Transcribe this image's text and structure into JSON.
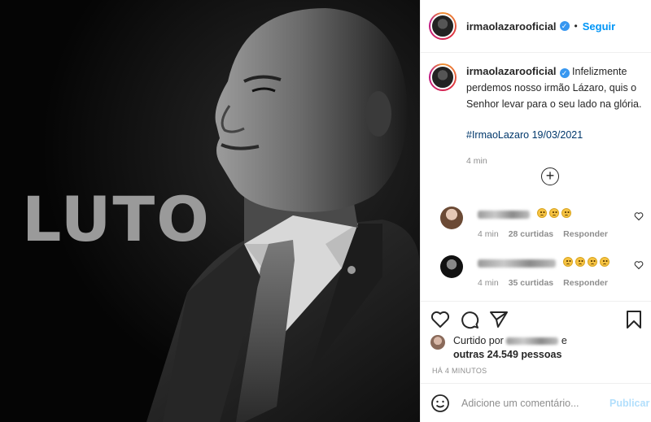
{
  "post": {
    "image_text": "LUTO",
    "header": {
      "username": "irmaolazarooficial",
      "verified_icon": "verified-badge-icon",
      "separator": "•",
      "follow_label": "Seguir"
    },
    "caption": {
      "username": "irmaolazarooficial",
      "text": "Infelizmente perdemos nosso irmão Lázaro, quis o Senhor levar para o seu lado na glória.",
      "hashtag": "#IrmaoLazaro",
      "date": "19/03/2021",
      "time": "4 min"
    },
    "comments": [
      {
        "time": "4 min",
        "likes": "28 curtidas",
        "reply": "Responder",
        "emoji_count": 3
      },
      {
        "time": "4 min",
        "likes": "35 curtidas",
        "reply": "Responder",
        "emoji_count": 4
      }
    ],
    "likes": {
      "prefix": "Curtido por",
      "conj": "e",
      "others": "outras 24.549 pessoas"
    },
    "timestamp": "HÁ 4 MINUTOS",
    "add_comment": {
      "placeholder": "Adicione um comentário...",
      "publish_label": "Publicar"
    },
    "colors": {
      "link_blue": "#0095f6",
      "hashtag_blue": "#00376b",
      "muted": "#8e8e8e",
      "publish_disabled": "#b2dffc"
    }
  }
}
